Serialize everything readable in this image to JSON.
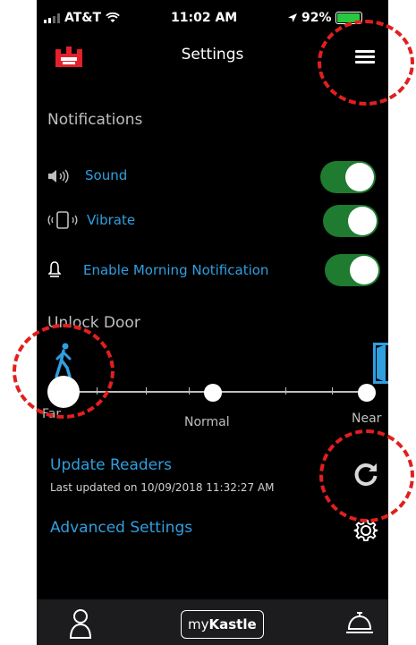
{
  "status_bar": {
    "carrier": "AT&T",
    "time": "11:02 AM",
    "battery": "92%",
    "battery_level": 0.92
  },
  "header": {
    "title": "Settings",
    "logo_icon": "castle-logo-icon",
    "menu_icon": "hamburger-menu-icon"
  },
  "notifications": {
    "section_title": "Notifications",
    "items": [
      {
        "label": "Sound",
        "icon": "speaker-icon",
        "enabled": true
      },
      {
        "label": "Vibrate",
        "icon": "vibrate-phone-icon",
        "enabled": true
      },
      {
        "label": "Enable Morning Notification",
        "icon": "bell-icon",
        "enabled": true
      }
    ]
  },
  "unlock_door": {
    "section_title": "Unlock Door",
    "slider_labels": [
      "Far",
      "Normal",
      "Near"
    ],
    "selected": "Far"
  },
  "update_readers": {
    "label": "Update Readers",
    "last_updated": "Last updated on 10/09/2018 11:32:27 AM",
    "icon": "refresh-icon"
  },
  "advanced_settings": {
    "label": "Advanced Settings",
    "icon": "gear-icon"
  },
  "tab_bar": {
    "brand_prefix": "my",
    "brand_name": "Kastle",
    "icons": [
      "person-icon",
      "concierge-bell-icon"
    ]
  },
  "colors": {
    "accent_blue": "#2f9fe0",
    "toggle_green": "#1e7b2f",
    "annotation_red": "#e0201e"
  }
}
